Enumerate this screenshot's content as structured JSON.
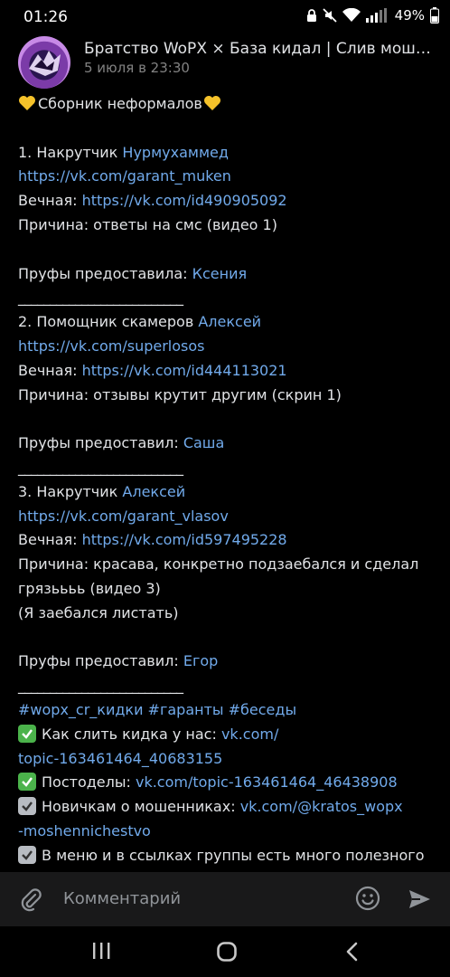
{
  "status": {
    "time": "01:26",
    "battery": "49%"
  },
  "header": {
    "title": "Братство WoPX × База кидал | Слив мошенни...",
    "date": "5 июля в 23:30"
  },
  "post": {
    "heading": "Сборник неформалов",
    "entry1": {
      "prefix": "1. Накрутчик ",
      "name": "Нурмухаммед",
      "url": "https://vk.com/garant_muken",
      "perm_label": "Вечная: ",
      "perm_url": "https://vk.com/id490905092",
      "reason": "Причина: ответы на смс (видео 1)",
      "proof_label": "Пруфы предоставила: ",
      "proof_name": "Ксения"
    },
    "divider": "__________________________",
    "entry2": {
      "prefix": "2. Помощник скамеров ",
      "name": "Алексей",
      "url": "https://vk.com/superlosos",
      "perm_label": "Вечная: ",
      "perm_url": "https://vk.com/id444113021",
      "reason": "Причина: отзывы крутит другим (скрин 1)",
      "proof_label": "Пруфы предоставил: ",
      "proof_name": "Саша"
    },
    "entry3": {
      "prefix": "3. Накрутчик ",
      "name": "Алексей",
      "url": "https://vk.com/garant_vlasov",
      "perm_label": "Вечная: ",
      "perm_url": "https://vk.com/id597495228",
      "reason1": "Причина: красава, конкретно подзаебался и сделал",
      "reason2": "грязьььь (видео 3)",
      "reason3": "(Я заебался листать)",
      "proof_label": "Пруфы предоставил: ",
      "proof_name": "Егор"
    },
    "hashtags": "#wopx_cr_кидки #гаранты #беседы",
    "how_label": "Как слить кидка у нас: ",
    "how_link1": "vk.com/",
    "how_link2": "topic-163461464_40683155",
    "posts_label": "Постоделы: ",
    "posts_link": "vk.com/topic-163461464_46438908",
    "newbie_label": "Новичкам о мошенниках: ",
    "newbie_link1": "vk.com/@kratos_wopx",
    "newbie_link2": "-moshennichestvo",
    "menu_text": "В меню и в ссылках группы есть много полезного"
  },
  "comment": {
    "placeholder": "Комментарий"
  },
  "colors": {
    "link": "#71aaeb",
    "text": "#e1e3e6",
    "muted": "#828282",
    "check_green": "#4bb34b",
    "bar_bg": "#19191a"
  },
  "icons": [
    "lock-icon",
    "mute-icon",
    "wifi-icon",
    "signal-icon",
    "battery-icon",
    "heart-icon",
    "check-icon",
    "attach-icon",
    "smile-icon",
    "send-icon",
    "recent-apps-icon",
    "home-icon",
    "back-icon"
  ]
}
